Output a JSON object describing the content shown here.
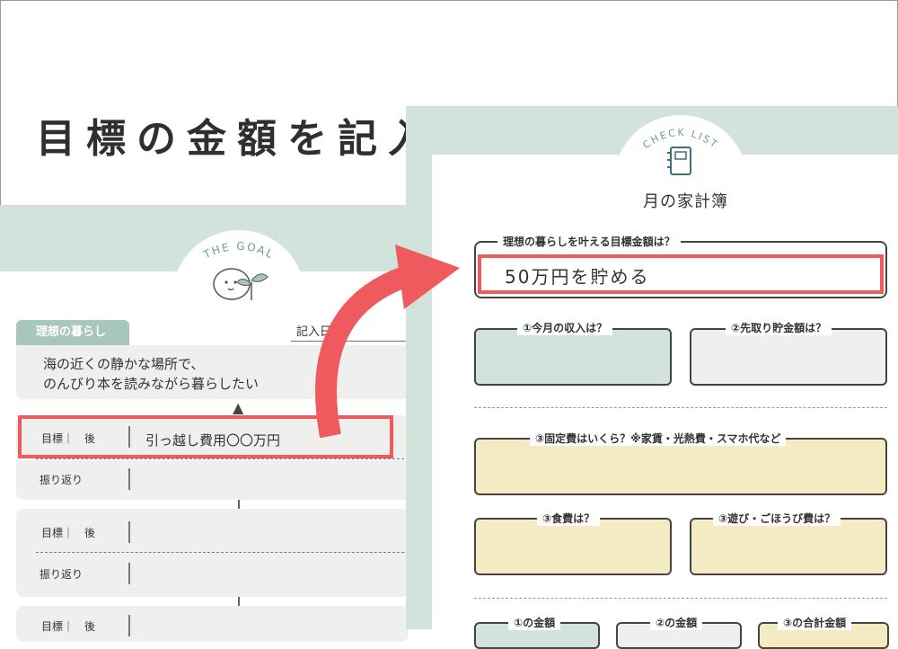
{
  "title": "目標の金額を記入",
  "left": {
    "goal_arc_text": "THE GOAL",
    "dream_tag": "理想の暮らし",
    "date_label": "記入日",
    "dream_text": "海の近くの静かな場所で、\nのんびり本を読みながら暮らしたい",
    "rows": [
      {
        "label": "目標｜　後",
        "value": "引っ越し費用〇〇万円"
      },
      {
        "label": "振り返り"
      },
      {
        "label": "目標｜　後"
      },
      {
        "label": "振り返り"
      },
      {
        "label": "目標｜　後"
      }
    ]
  },
  "right": {
    "arc_text": "CHECK LIST",
    "sheet_title": "月の家計簿",
    "goal_label": "理想の暮らしを叶える目標金額は？",
    "goal_value": "50万円を貯める",
    "income_label": "①今月の収入は？",
    "savings_label": "②先取り貯金額は？",
    "fixed_label": "③固定費はいくら？※家賃・光熱費・スマホ代など",
    "food_label": "③食費は？",
    "fun_label": "③遊び・ごほうび費は？",
    "sum1_label": "①の金額",
    "sum2_label": "②の金額",
    "sum3_label": "③の合計金額"
  },
  "colors": {
    "accent_red": "#ef5a5f",
    "sage": "#d2e3dc",
    "cream": "#f5ebc2",
    "tag_green": "#a7c7bb"
  }
}
